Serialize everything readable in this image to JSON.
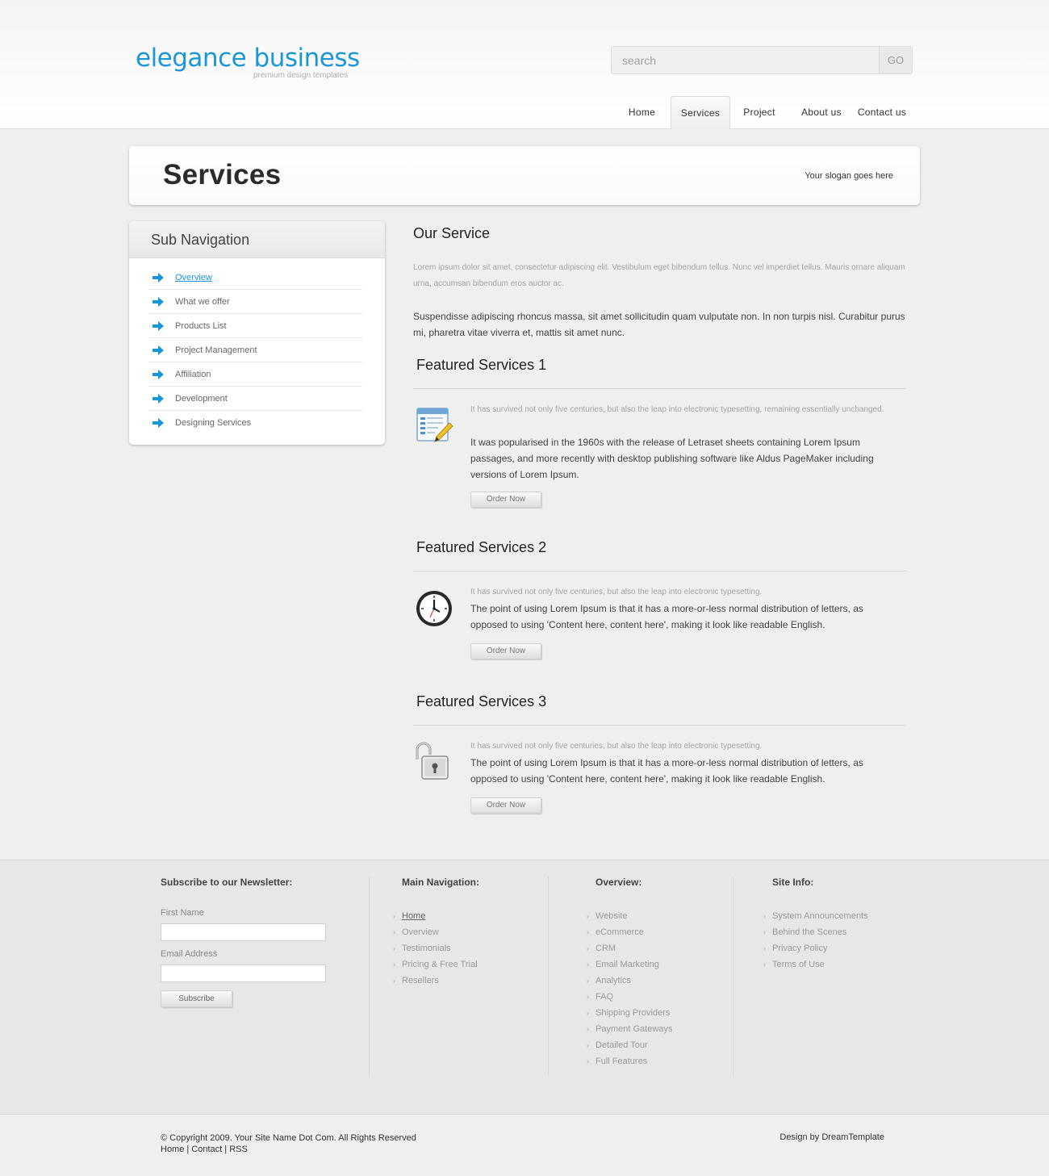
{
  "header": {
    "logo_title": "elegance business",
    "logo_subtitle": "premium design templates",
    "search_placeholder": "search",
    "search_button": "GO",
    "nav": [
      {
        "label": "Home",
        "active": false
      },
      {
        "label": "Services",
        "active": true
      },
      {
        "label": "Project",
        "active": false
      },
      {
        "label": "About us",
        "active": false
      },
      {
        "label": "Contact us",
        "active": false
      }
    ]
  },
  "page": {
    "title": "Services",
    "slogan": "Your slogan goes here"
  },
  "sidebar": {
    "title": "Sub Navigation",
    "items": [
      {
        "label": "Overview",
        "active": true
      },
      {
        "label": "What we offer",
        "active": false
      },
      {
        "label": "Products List",
        "active": false
      },
      {
        "label": "Project Management",
        "active": false
      },
      {
        "label": "Affiliation",
        "active": false
      },
      {
        "label": "Development",
        "active": false
      },
      {
        "label": "Designing Services",
        "active": false
      }
    ]
  },
  "main": {
    "heading": "Our Service",
    "intro_small": "Lorem ipsum dolor sit amet, consectetur adipiscing elit. Vestibulum eget bibendum tellus. Nunc vel imperdiet tellus. Mauris ornare aliquam urna, accumsan bibendum eros auctor ac.",
    "intro_body": "Suspendisse adipiscing rhoncus massa, sit amet sollicitudin quam vulputate non. In non turpis nisl. Curabitur purus mi, pharetra vitae viverra et, mattis sit amet nunc.",
    "features": [
      {
        "title": "Featured Services 1",
        "icon": "document-edit-icon",
        "small": "It has survived not only five centuries, but also the leap into electronic typesetting, remaining essentially unchanged.",
        "body": "It was popularised in the 1960s with the release of Letraset sheets containing Lorem Ipsum passages, and more recently with desktop publishing software like Aldus PageMaker including versions of Lorem Ipsum.",
        "button": "Order Now"
      },
      {
        "title": "Featured Services 2",
        "icon": "clock-icon",
        "small": "It has survived not only five centuries, but also the leap into electronic typesetting.",
        "body": "The point of using Lorem Ipsum is that it has a more-or-less normal distribution of letters, as opposed to using 'Content here, content here', making it look like readable English.",
        "button": "Order Now"
      },
      {
        "title": "Featured Services 3",
        "icon": "padlock-icon",
        "small": "It has survived not only five centuries, but also the leap into electronic typesetting.",
        "body": "The point of using Lorem Ipsum is that it has a more-or-less normal distribution of letters, as opposed to using 'Content here, content here', making it look like readable English.",
        "button": "Order Now"
      }
    ]
  },
  "footer": {
    "newsletter": {
      "title": "Subscribe to our Newsletter:",
      "first_name_label": "First Name",
      "first_name_value": "",
      "email_label": "Email Address",
      "email_value": "",
      "button": "Subscribe"
    },
    "main_nav": {
      "title": "Main Navigation:",
      "items": [
        "Home",
        "Overview",
        "Testimonials",
        "Pricing & Free Trial",
        "Resellers"
      ]
    },
    "overview": {
      "title": "Overview:",
      "items": [
        "Website",
        "eCommerce",
        "CRM",
        "Email Marketing",
        "Analytics",
        "FAQ",
        "Shipping Providers",
        "Payment Gateways",
        "Detailed Tour",
        "Full Features"
      ]
    },
    "site_info": {
      "title": "Site Info:",
      "items": [
        "System Announcements",
        "Behind the Scenes",
        "Privacy Policy",
        "Terms of Use"
      ]
    },
    "copyright": "© Copyright 2009. Your Site Name Dot Com. All Rights Reserved",
    "bottom_links": "Home | Contact | RSS",
    "credit": "Design by DreamTemplate"
  },
  "colors": {
    "accent": "#1b96d6",
    "background": "#efefef",
    "footer_bg": "#e7e7e7"
  }
}
